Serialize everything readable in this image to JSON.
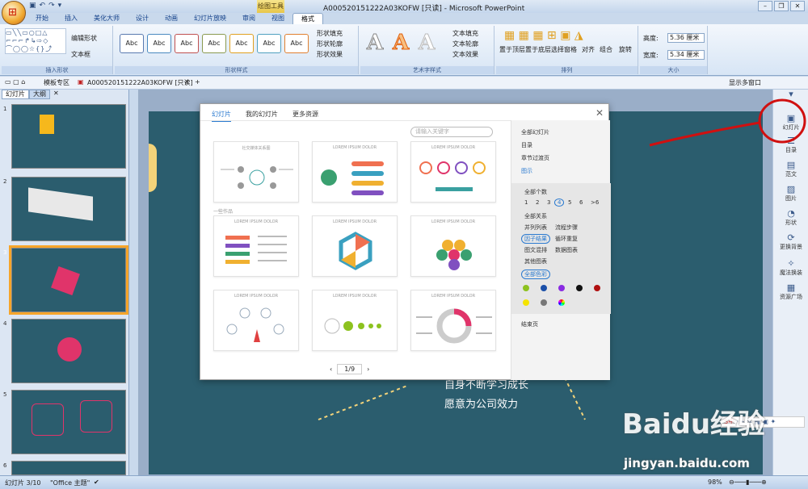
{
  "window": {
    "title": "A000520151222A03KOFW [只读] - Microsoft PowerPoint",
    "contextual_tab": "绘图工具"
  },
  "tabs": [
    "开始",
    "插入",
    "美化大师",
    "设计",
    "动画",
    "幻灯片放映",
    "审阅",
    "视图",
    "格式"
  ],
  "active_tab": "格式",
  "ribbon": {
    "insert_shapes": {
      "label": "插入形状",
      "edit_shape": "编辑形状",
      "textbox": "文本框"
    },
    "shape_styles": {
      "label": "形状样式",
      "styles": [
        "Abc",
        "Abc",
        "Abc",
        "Abc",
        "Abc",
        "Abc",
        "Abc"
      ],
      "fill": "形状填充",
      "outline": "形状轮廓",
      "effects": "形状效果"
    },
    "wordart": {
      "label": "艺术字样式",
      "text_fill": "文本填充",
      "text_outline": "文本轮廓",
      "text_effects": "文本效果"
    },
    "arrange": {
      "label": "排列",
      "bring_front": "置于顶层",
      "send_back": "置于底层",
      "selection_pane": "选择窗格",
      "align": "对齐",
      "group": "组合",
      "rotate": "旋转"
    },
    "size": {
      "label": "大小",
      "height_label": "高度:",
      "height": "5.36 厘米",
      "width_label": "宽度:",
      "width": "5.34 厘米"
    }
  },
  "doc_tabs": {
    "templates": "模板专区",
    "file": "A000520151222A03KOFW [只读]",
    "add": "+",
    "show_multi": "显示多窗口"
  },
  "slide_panel": {
    "tabs": [
      "幻灯片",
      "大纲"
    ],
    "numbers": [
      "1",
      "2",
      "3",
      "4",
      "5",
      "6"
    ],
    "selected": "3"
  },
  "slide_text": [
    "自身不断学习成长",
    "愿意为公司效力"
  ],
  "dialog": {
    "tabs": [
      "幻灯片",
      "我的幻灯片",
      "更多资源"
    ],
    "search_placeholder": "请输入关键字",
    "section_label": "一些作品",
    "card_titles": [
      "社交媒体关系图",
      "LOREM IPSUM DOLOR",
      "LOREM IPSUM DOLOR",
      "LOREM IPSUM DOLOR",
      "LOREM IPSUM DOLOR",
      "LOREM IPSUM DOLOR",
      "LOREM IPSUM DOLOR",
      "LOREM IPSUM DOLOR",
      "LOREM IPSUM DOLOR"
    ],
    "pager": {
      "prev": "‹",
      "page": "1/9",
      "next": "›"
    },
    "filter": {
      "items": [
        "全部幻灯片",
        "目录",
        "章节过渡页",
        "图示"
      ],
      "count_label": "全部个数",
      "counts": [
        "1",
        "2",
        "3",
        "4",
        "5",
        "6",
        ">6"
      ],
      "selected_count": "4",
      "relations": [
        "全部关系",
        "并列列表",
        "流程步骤",
        "因子结果",
        "循环重复",
        "图文混排",
        "数据图表",
        "其他图表"
      ],
      "selected_relation": "因子结果",
      "color_label": "全部色彩",
      "colors": [
        "#8dc21f",
        "#1a4fa8",
        "#8a2be2",
        "#111111",
        "#b01010",
        "#f5e400",
        "#777777",
        "conic"
      ],
      "end_page": "结束页"
    }
  },
  "right_sidebar": [
    "幻灯片",
    "目录",
    "范文",
    "图片",
    "形状",
    "更换背景",
    "魔法换装",
    "资源广场"
  ],
  "status": {
    "slide": "幻灯片 3/10",
    "theme": "\"Office 主题\"",
    "zoom": "98%"
  },
  "watermark": {
    "brand": "Baidu经验",
    "url": "jingyan.baidu.com"
  },
  "ime": {
    "label": "S中"
  }
}
